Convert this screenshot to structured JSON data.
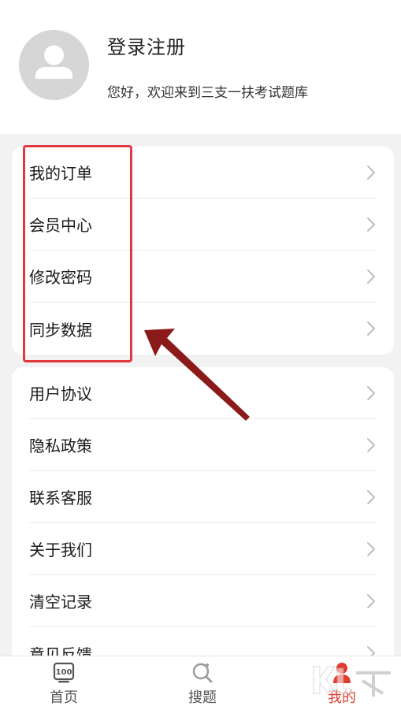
{
  "profile": {
    "title": "登录注册",
    "welcome": "您好，欢迎来到三支一扶考试题库"
  },
  "menu_group_1": {
    "items": [
      {
        "label": "我的订单"
      },
      {
        "label": "会员中心"
      },
      {
        "label": "修改密码"
      },
      {
        "label": "同步数据"
      }
    ]
  },
  "menu_group_2": {
    "items": [
      {
        "label": "用户协议"
      },
      {
        "label": "隐私政策"
      },
      {
        "label": "联系客服"
      },
      {
        "label": "关于我们"
      },
      {
        "label": "清空记录"
      },
      {
        "label": "意见反馈"
      }
    ]
  },
  "tabbar": {
    "home": "首页",
    "search": "搜题",
    "mine": "我的",
    "home_icon_text": "100",
    "active_color": "#e23a2e"
  },
  "colors": {
    "highlight": "#e0393f",
    "arrow": "#8b1a1a",
    "background": "#f2f2f2"
  },
  "icons": {
    "avatar": "user-avatar-icon",
    "chevron": "chevron-right-icon",
    "home": "score-board-icon",
    "search": "search-magnifier-icon",
    "mine": "person-icon"
  }
}
